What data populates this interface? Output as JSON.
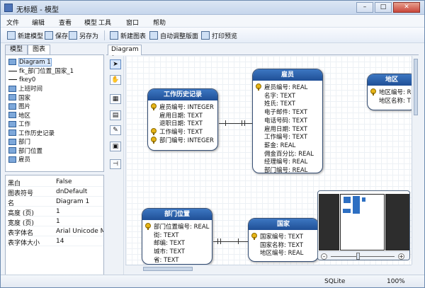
{
  "window": {
    "title": "无标题 - 模型",
    "controls": [
      "–",
      "□",
      "✕"
    ]
  },
  "menu": [
    "文件",
    "编辑",
    "查看",
    "模型",
    "工具",
    "窗口",
    "帮助"
  ],
  "toolbar": {
    "new_model": "新建模型",
    "save": "保存",
    "save_as": "另存为",
    "new_diagram": "新建图表",
    "auto_layout": "自动调整版面",
    "print_preview": "打印预览"
  },
  "left_tabs": [
    "模型",
    "图表"
  ],
  "tree": [
    {
      "label": "Diagram 1",
      "icon": "diagram-icon",
      "selected": true
    },
    {
      "label": "fk_部门位置_国家_1",
      "icon": "relation-icon"
    },
    {
      "label": "fkey0",
      "icon": "relation-icon"
    },
    {
      "label": "上班时间",
      "icon": "table-icon"
    },
    {
      "label": "国家",
      "icon": "table-icon"
    },
    {
      "label": "图片",
      "icon": "table-icon"
    },
    {
      "label": "地区",
      "icon": "table-icon"
    },
    {
      "label": "工作",
      "icon": "table-icon"
    },
    {
      "label": "工作历史记录",
      "icon": "table-icon"
    },
    {
      "label": "部门",
      "icon": "table-icon"
    },
    {
      "label": "部门位置",
      "icon": "table-icon"
    },
    {
      "label": "雇员",
      "icon": "table-icon"
    }
  ],
  "properties": [
    {
      "key": "黑白",
      "value": "False"
    },
    {
      "key": "图表符号",
      "value": "dnDefault"
    },
    {
      "key": "名",
      "value": "Diagram 1"
    },
    {
      "key": "高度 (页)",
      "value": "1"
    },
    {
      "key": "宽度 (页)",
      "value": "1"
    },
    {
      "key": "表字体名",
      "value": "Arial Unicode M"
    },
    {
      "key": "表字体大小",
      "value": "14"
    }
  ],
  "diagram_tab": "Diagram 1",
  "entities": [
    {
      "name": "工作历史记录",
      "rows": [
        {
          "text": "雇员编号: INTEGER",
          "key": true
        },
        {
          "text": "雇用日期: TEXT",
          "key": false
        },
        {
          "text": "退职日期: TEXT",
          "key": false
        },
        {
          "text": "工作编号: TEXT",
          "key": true
        },
        {
          "text": "部门编号: INTEGER",
          "key": true
        }
      ]
    },
    {
      "name": "雇员",
      "rows": [
        {
          "text": "雇员编号: REAL",
          "key": true
        },
        {
          "text": "名字: TEXT",
          "key": false
        },
        {
          "text": "姓氏: TEXT",
          "key": false
        },
        {
          "text": "电子邮件: TEXT",
          "key": false
        },
        {
          "text": "电话号码: TEXT",
          "key": false
        },
        {
          "text": "雇用日期: TEXT",
          "key": false
        },
        {
          "text": "工作编号: TEXT",
          "key": false
        },
        {
          "text": "薪金: REAL",
          "key": false
        },
        {
          "text": "佣金百分比: REAL",
          "key": false
        },
        {
          "text": "经理编号: REAL",
          "key": false
        },
        {
          "text": "部门编号: REAL",
          "key": false
        }
      ]
    },
    {
      "name": "地区",
      "rows": [
        {
          "text": "地区编号: R",
          "key": true
        },
        {
          "text": "地区名称: T",
          "key": false
        }
      ]
    },
    {
      "name": "部门位置",
      "rows": [
        {
          "text": "部门位置编号: REAL",
          "key": true
        },
        {
          "text": "街: TEXT",
          "key": false
        },
        {
          "text": "邮编: TEXT",
          "key": false
        },
        {
          "text": "城市: TEXT",
          "key": false
        },
        {
          "text": "省: TEXT",
          "key": false
        }
      ]
    },
    {
      "name": "国家",
      "rows": [
        {
          "text": "国家编号: TEXT",
          "key": true
        },
        {
          "text": "国家名称: TEXT",
          "key": false
        },
        {
          "text": "地区编号: REAL",
          "key": false
        }
      ]
    }
  ],
  "status": {
    "db": "SQLite",
    "zoom": "100%"
  }
}
